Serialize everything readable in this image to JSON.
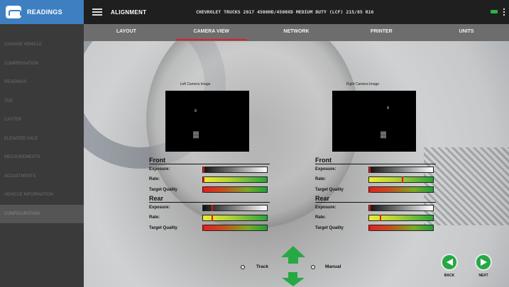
{
  "sidebar": {
    "brand_label": "READINGS",
    "items": [
      {
        "label": "CHANGE VEHICLE",
        "active": false
      },
      {
        "label": "COMPENSATION",
        "active": false
      },
      {
        "label": "READINGS",
        "active": false
      },
      {
        "label": "TOE",
        "active": false
      },
      {
        "label": "CASTER",
        "active": false
      },
      {
        "label": "ELEVATED AXLE",
        "active": false
      },
      {
        "label": "MEASUREMENTS",
        "active": false
      },
      {
        "label": "ADJUSTMENTS",
        "active": false
      },
      {
        "label": "VEHICLE INFORMATION",
        "active": false
      },
      {
        "label": "CONFIGURATION",
        "active": true
      }
    ]
  },
  "header": {
    "title": "ALIGNMENT",
    "vehicle": "CHEVROLET TRUCKS 2017 4500HD/4500XD MEDIUM DUTY (LCF) 215/85 R16",
    "status_color": "#2bb24c"
  },
  "tabs": [
    {
      "label": "LAYOUT",
      "active": false
    },
    {
      "label": "CAMERA VIEW",
      "active": true
    },
    {
      "label": "NETWORK",
      "active": false
    },
    {
      "label": "PRINTER",
      "active": false
    },
    {
      "label": "UNITS",
      "active": false
    }
  ],
  "left_camera": {
    "label": "Left Camera Image",
    "front": {
      "title": "Front",
      "exposure_label": "Exposure:",
      "rate_label": "Rate:",
      "quality_label": "Target Quality",
      "exposure_pct": 1,
      "rate_pct": 1,
      "quality_pct": 1
    },
    "rear": {
      "title": "Rear",
      "exposure_label": "Exposure:",
      "rate_label": "Rate:",
      "quality_label": "Target Quality",
      "exposure_pct": 14,
      "rate_pct": 14,
      "quality_pct": 1
    }
  },
  "right_camera": {
    "label": "Right Camera Image",
    "front": {
      "title": "Front",
      "exposure_label": "Exposure:",
      "rate_label": "Rate:",
      "quality_label": "Target Quality",
      "exposure_pct": 1,
      "rate_pct": 52,
      "quality_pct": 1
    },
    "rear": {
      "title": "Rear",
      "exposure_label": "Exposure:",
      "rate_label": "Rate:",
      "quality_label": "Target Quality",
      "exposure_pct": 1,
      "rate_pct": 18,
      "quality_pct": 1
    }
  },
  "mode": {
    "track_label": "Track",
    "manual_label": "Manual"
  },
  "navigation": {
    "back_label": "BACK",
    "next_label": "NEXT"
  },
  "colors": {
    "brand_blue": "#3d7fc1",
    "accent_red": "#d22222",
    "button_green": "#27a845"
  }
}
